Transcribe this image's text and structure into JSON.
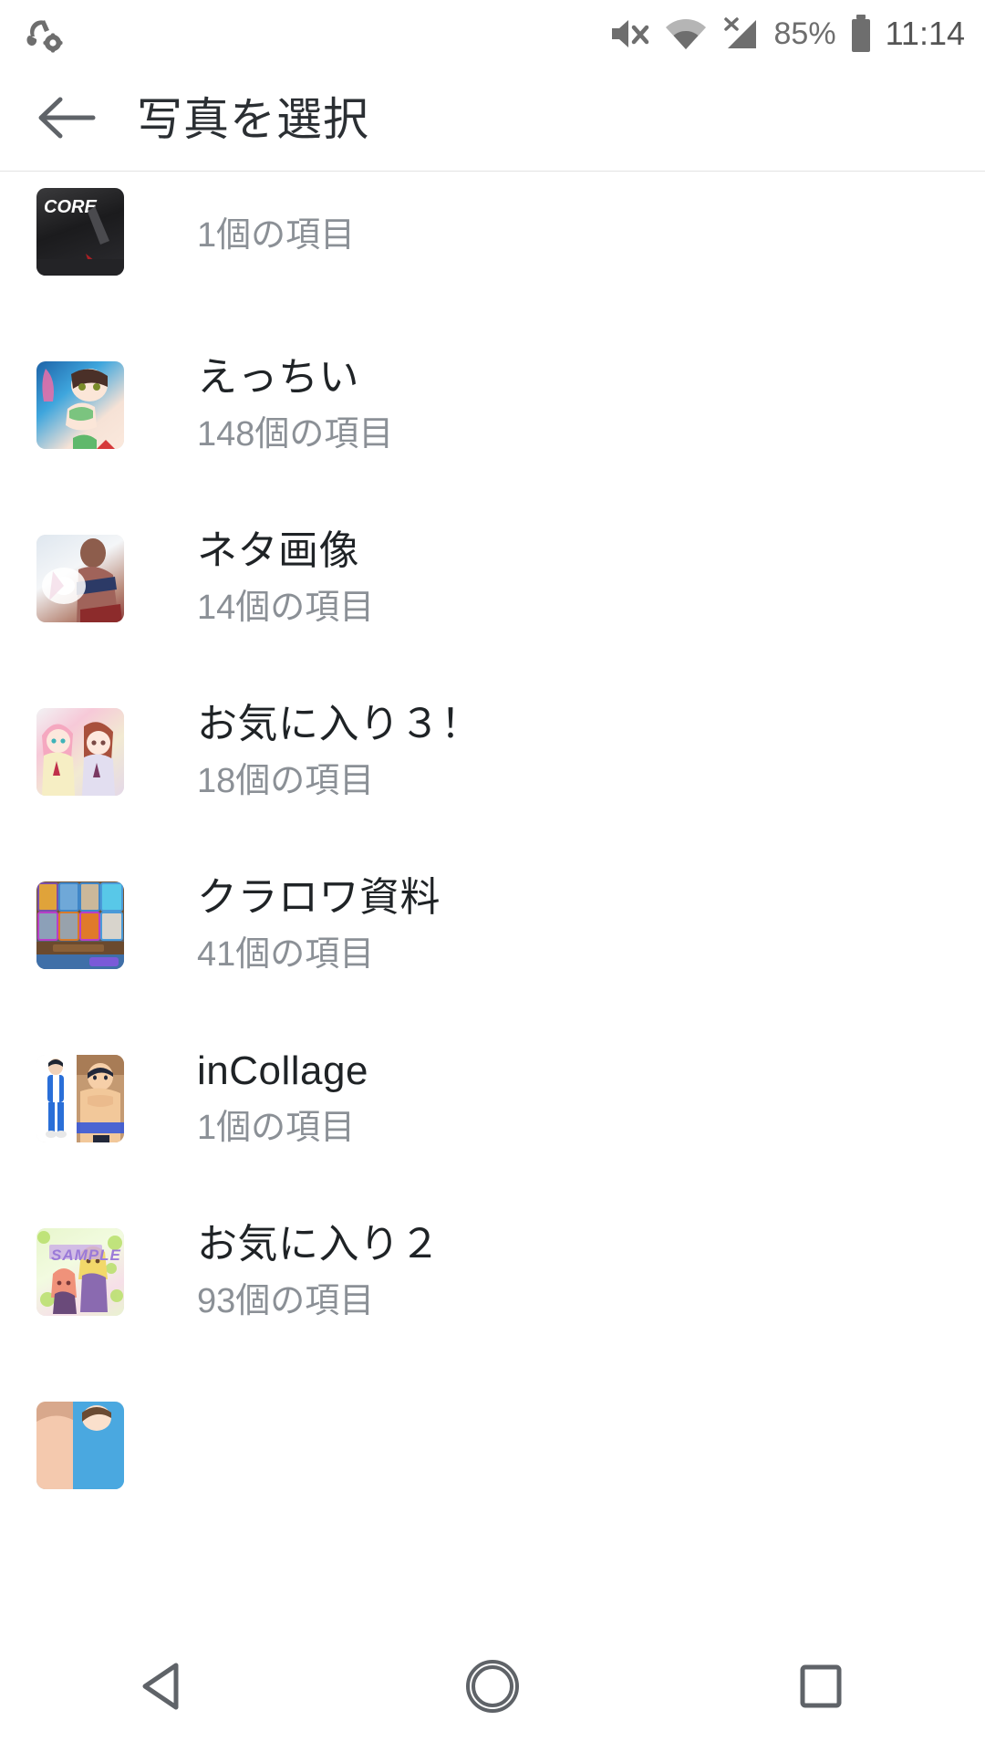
{
  "status_bar": {
    "left_icon": "headphone-settings-icon",
    "icons": [
      "volume-mute-icon",
      "wifi-icon",
      "no-sim-signal-icon"
    ],
    "battery_percent": "85%",
    "battery_icon": "battery-icon",
    "time": "11:14"
  },
  "app_bar": {
    "back_icon": "arrow-back-icon",
    "title": "写真を選択"
  },
  "albums": [
    {
      "title": "",
      "count": "1個の項目",
      "thumb": "core-thumbnail",
      "thumb_label": "CORE",
      "art_class": "art-core",
      "clipped": true
    },
    {
      "title": "えっちい",
      "count": "148個の項目",
      "thumb": "ecchi-thumbnail",
      "thumb_label": "",
      "art_class": "art-ecchi",
      "clipped": false
    },
    {
      "title": "ネタ画像",
      "count": "14個の項目",
      "thumb": "neta-thumbnail",
      "thumb_label": "",
      "art_class": "art-neta",
      "clipped": false
    },
    {
      "title": "お気に入り３！",
      "count": "18個の項目",
      "thumb": "favorite3-thumbnail",
      "thumb_label": "",
      "art_class": "art-fav3",
      "clipped": false
    },
    {
      "title": "クラロワ資料",
      "count": "41個の項目",
      "thumb": "clashroyale-thumbnail",
      "thumb_label": "",
      "art_class": "art-clash",
      "clipped": false
    },
    {
      "title": "inCollage",
      "count": "1個の項目",
      "thumb": "incollage-thumbnail",
      "thumb_label": "",
      "art_class": "art-incol",
      "clipped": false
    },
    {
      "title": "お気に入り２",
      "count": "93個の項目",
      "thumb": "favorite2-thumbnail",
      "thumb_label": "SAMPLE",
      "art_class": "art-fav2",
      "clipped": false
    },
    {
      "title": "",
      "count": "",
      "thumb": "next-album-thumbnail",
      "thumb_label": "",
      "art_class": "art-next",
      "clipped": false
    }
  ],
  "nav_bar": {
    "back_icon": "nav-back-triangle-icon",
    "home_icon": "nav-home-circle-icon",
    "recents_icon": "nav-recents-square-icon"
  },
  "colors": {
    "background": "#ffffff",
    "title_text": "#1f2326",
    "subtitle_text": "#8b9096",
    "status_icon": "#6e6e6e",
    "divider": "#e2e2e2"
  }
}
